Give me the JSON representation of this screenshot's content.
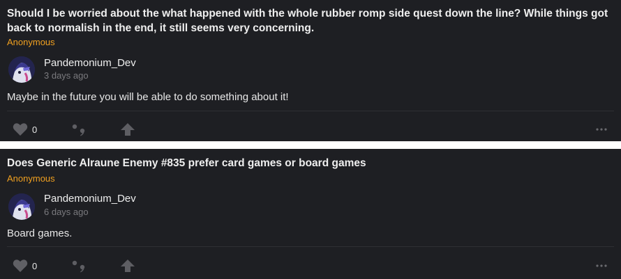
{
  "posts": [
    {
      "question": "Should I be worried about the what happened with the whole rubber romp side quest down the line? While things got back to normalish in the end, it still seems very concerning.",
      "asker": "Anonymous",
      "author": "Pandemonium_Dev",
      "time": "3 days ago",
      "answer": "Maybe in the future you will be able to do something about it!",
      "likes": "0",
      "icons": [
        "heart-icon",
        "quote-icon",
        "arrow-up-icon",
        "more-dots-icon"
      ]
    },
    {
      "question": "Does Generic Alraune Enemy #835 prefer card games or board games",
      "asker": "Anonymous",
      "author": "Pandemonium_Dev",
      "time": "6 days ago",
      "answer": "Board games.",
      "likes": "0",
      "icons": [
        "heart-icon",
        "quote-icon",
        "arrow-up-icon",
        "more-dots-icon"
      ]
    }
  ],
  "colors": {
    "card_bg": "#1e1f23",
    "asker": "#f0a020",
    "muted": "#7a7a7e",
    "separator": "#ffffff"
  }
}
